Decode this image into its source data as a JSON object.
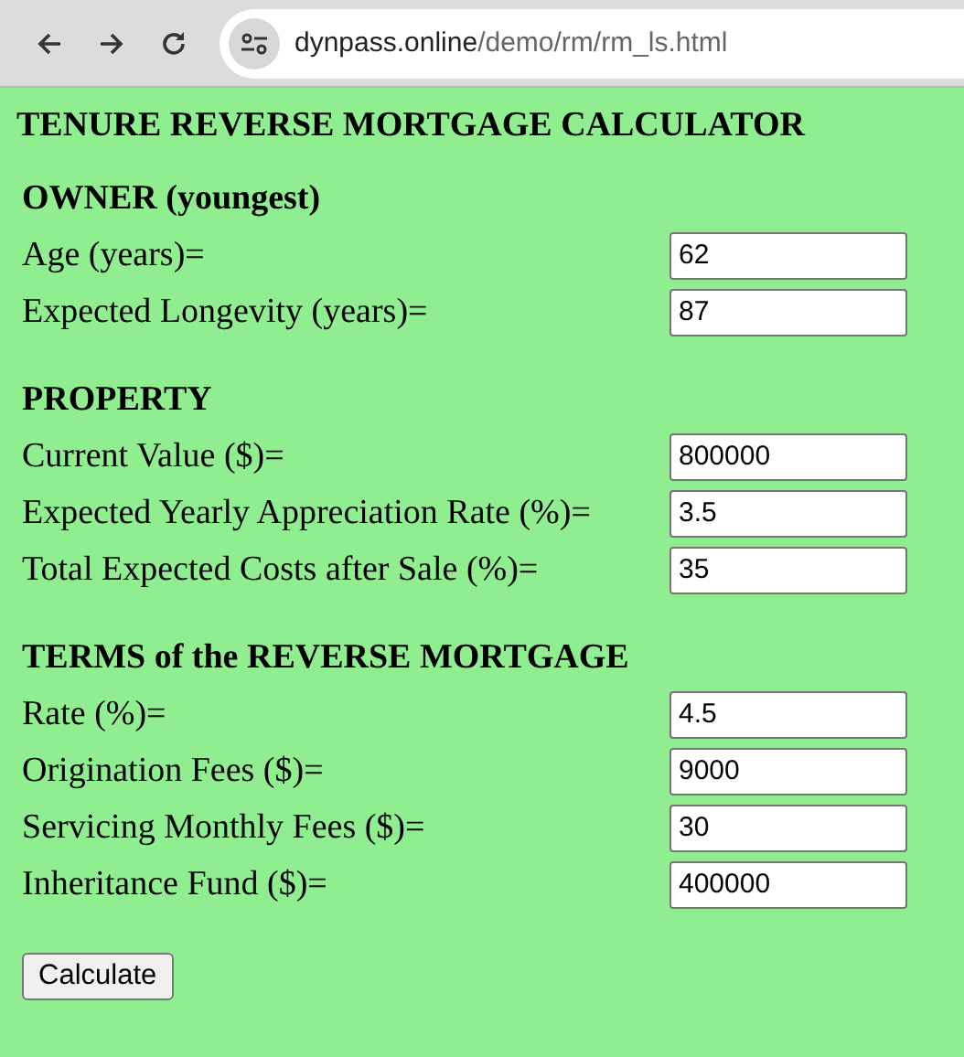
{
  "browser": {
    "url_host": "dynpass.online",
    "url_path": "/demo/rm/rm_ls.html"
  },
  "title": "TENURE REVERSE MORTGAGE CALCULATOR",
  "sections": [
    {
      "heading": "OWNER (youngest)",
      "fields": [
        {
          "label": "Age (years)=",
          "value": "62"
        },
        {
          "label": "Expected Longevity (years)=",
          "value": "87"
        }
      ]
    },
    {
      "heading": "PROPERTY",
      "fields": [
        {
          "label": "Current Value ($)=",
          "value": "800000"
        },
        {
          "label": "Expected Yearly Appreciation Rate (%)=",
          "value": "3.5"
        },
        {
          "label": "Total Expected Costs after Sale (%)=",
          "value": "35"
        }
      ]
    },
    {
      "heading": "TERMS of the REVERSE MORTGAGE",
      "fields": [
        {
          "label": "Rate (%)=",
          "value": "4.5"
        },
        {
          "label": "Origination Fees ($)=",
          "value": "9000"
        },
        {
          "label": "Servicing Monthly Fees ($)=",
          "value": "30"
        },
        {
          "label": "Inheritance Fund ($)=",
          "value": "400000"
        }
      ]
    }
  ],
  "button": "Calculate"
}
